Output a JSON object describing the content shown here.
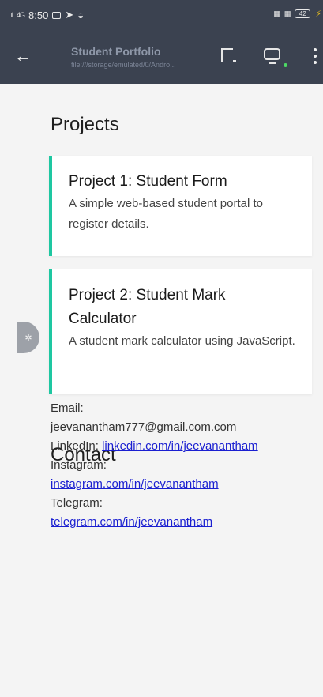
{
  "status_bar": {
    "network": "4G",
    "time": "8:50",
    "battery": "42"
  },
  "app_bar": {
    "title": "Student Portfolio",
    "url": "file:///storage/emulated/0/Andro..."
  },
  "projects": {
    "heading": "Projects",
    "items": [
      {
        "title": "Project 1: Student Form",
        "description": "A simple web-based student portal to register details."
      },
      {
        "title": "Project 2: Student Mark Calculator",
        "description": "A student mark calculator using JavaScript."
      }
    ]
  },
  "contact": {
    "heading": "Contact",
    "email_label": "Email:",
    "email_value": "jeevanantham777@gmail.com.com",
    "linkedin_label": "LinkedIn:",
    "linkedin_link": "linkedin.com/in/jeevanantham",
    "instagram_label": "Instagram:",
    "instagram_link": "instagram.com/in/jeevanantham",
    "telegram_label": "Telegram:",
    "telegram_link": "telegram.com/in/jeevanantham"
  },
  "colors": {
    "app_bar_bg": "#3b4250",
    "card_accent": "#1ec7a1",
    "link": "#1a1fd1",
    "page_bg": "#f4f4f4"
  },
  "icons": {
    "back": "arrow-left-icon",
    "tab_switch": "tab-switch-icon",
    "chat": "chat-icon",
    "menu": "more-vertical-icon",
    "floating": "sparkle-icon"
  }
}
